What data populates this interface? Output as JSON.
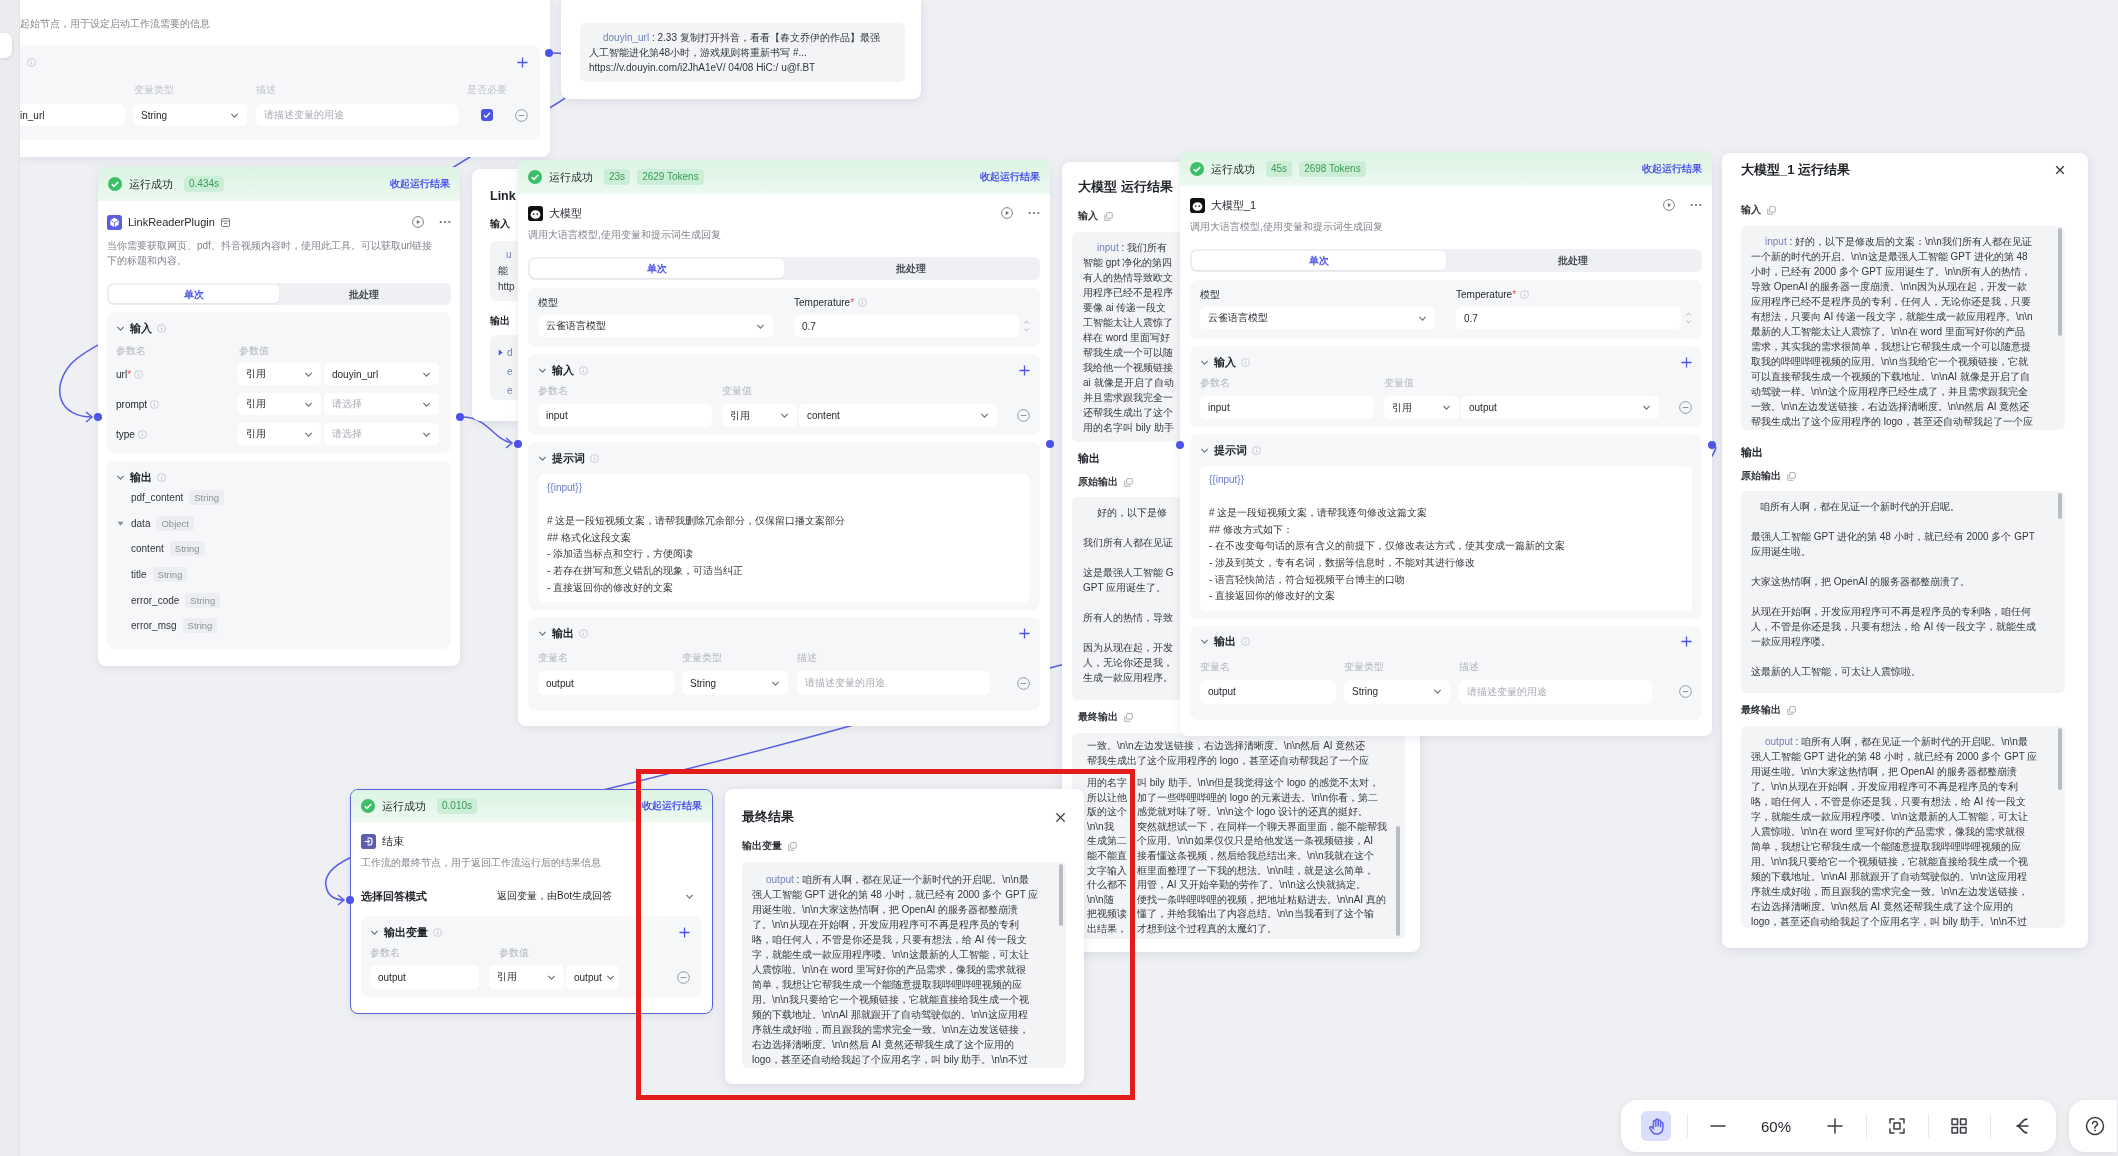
{
  "start_node": {
    "description": "起始节点，用于设定启动工作流需要的信息",
    "columns": [
      "变量类型",
      "描述",
      "是否必要"
    ],
    "variables": [
      {
        "name": "in_url",
        "type": "String",
        "placeholder": "请描述变量的用途",
        "required": true
      }
    ]
  },
  "start_result": {
    "input": {
      "key": "douyin_url",
      "lines": [
        " : 2.33 复制打开抖音，看看【春文乔伊的作品】最强",
        "人工智能进化第48小时，游戏规则将重新书写 #...",
        "https://v.douyin.com/i2JhA1eV/ 04/08 HiC:/ u@f.BT"
      ]
    }
  },
  "link_reader_node": {
    "status": {
      "kind": "success",
      "label": "运行成功",
      "badges": [
        "0.434s"
      ],
      "collapse_link": "收起运行结果"
    },
    "title": "LinkReaderPlugin",
    "description": "当你需要获取网页、pdf、抖音视频内容时，使用此工具。可以获取url链接下的标题和内容。",
    "tabs": [
      {
        "label": "单次",
        "selected": true
      },
      {
        "label": "批处理",
        "selected": false
      }
    ],
    "input": {
      "title": "输入",
      "columns": [
        "参数名",
        "参数值"
      ],
      "params": [
        {
          "name": "url",
          "required_mark": "*",
          "source": "引用",
          "value": "douyin_url"
        },
        {
          "name": "prompt",
          "source": "引用",
          "placeholder": "请选择"
        },
        {
          "name": "type",
          "source": "引用",
          "placeholder": "请选择"
        }
      ]
    },
    "output": {
      "title": "输出",
      "fields": [
        {
          "name": "pdf_content",
          "type": "String"
        },
        {
          "name": "data",
          "type": "Object",
          "expanded": true,
          "children": [
            {
              "name": "content",
              "type": "String"
            },
            {
              "name": "title",
              "type": "String"
            },
            {
              "name": "error_code",
              "type": "String"
            },
            {
              "name": "error_msg",
              "type": "String"
            }
          ]
        }
      ]
    }
  },
  "link_result_panel": {
    "title": "Link",
    "input_label": "输入",
    "input": {
      "key": "u",
      "lines": [
        "能",
        "http"
      ]
    },
    "output_label": "输出",
    "output_items": [
      {
        "name": "d",
        "expanded": false
      },
      {
        "name": "e"
      },
      {
        "name": "e"
      }
    ]
  },
  "llm_nodes": [
    {
      "status": {
        "kind": "success",
        "label": "运行成功",
        "badges": [
          "23s",
          "2629 Tokens"
        ],
        "collapse_link": "收起运行结果"
      },
      "title": "大模型",
      "description": "调用大语言模型,使用变量和提示词生成回复",
      "tabs": [
        {
          "label": "单次",
          "selected": true
        },
        {
          "label": "批处理",
          "selected": false
        }
      ],
      "model": {
        "label": "模型",
        "value": "云雀语言模型"
      },
      "temperature": {
        "label": "Temperature",
        "required_mark": "*",
        "value": "0.7"
      },
      "input": {
        "title": "输入",
        "columns": [
          "参数名",
          "变量值"
        ],
        "params": [
          {
            "name": "input",
            "source": "引用",
            "value": "content"
          }
        ]
      },
      "prompt": {
        "title": "提示词",
        "variable": "{{input}}",
        "lines": [
          "# 这是一段短视频文案，请帮我删除冗余部分，仅保留口播文案部分",
          "## 格式化这段文案",
          "- 添加适当标点和空行，方便阅读",
          "- 若存在拼写和意义错乱的现象，可适当纠正",
          "- 直接返回你的修改好的文案"
        ]
      },
      "output": {
        "title": "输出",
        "columns": [
          "变量名",
          "变量类型",
          "描述"
        ],
        "vars": [
          {
            "name": "output",
            "type": "String",
            "placeholder": "请描述变量的用途"
          }
        ]
      }
    },
    {
      "status": {
        "kind": "success",
        "label": "运行成功",
        "badges": [
          "45s",
          "2698 Tokens"
        ],
        "collapse_link": "收起运行结果"
      },
      "title": "大模型_1",
      "description": "调用大语言模型,使用变量和提示词生成回复",
      "tabs": [
        {
          "label": "单次",
          "selected": true
        },
        {
          "label": "批处理",
          "selected": false
        }
      ],
      "model": {
        "label": "模型",
        "value": "云雀语言模型"
      },
      "temperature": {
        "label": "Temperature",
        "required_mark": "*",
        "value": "0.7"
      },
      "input": {
        "title": "输入",
        "columns": [
          "参数名",
          "变量值"
        ],
        "params": [
          {
            "name": "input",
            "source": "引用",
            "value": "output"
          }
        ]
      },
      "prompt": {
        "title": "提示词",
        "variable": "{{input}}",
        "lines": [
          "# 这是一段短视频文案，请帮我逐句修改这篇文案",
          "## 修改方式如下：",
          "- 在不改变每句话的原有含义的前提下，仅修改表达方式，使其变成一篇新的文案",
          "- 涉及到英文，专有名词，数据等信息时，不能对其进行修改",
          "- 语言轻快简洁，符合短视频平台博主的口吻",
          "- 直接返回你的修改好的文案"
        ]
      },
      "output": {
        "title": "输出",
        "columns": [
          "变量名",
          "变量类型",
          "描述"
        ],
        "vars": [
          {
            "name": "output",
            "type": "String",
            "placeholder": "请描述变量的用途"
          }
        ]
      }
    }
  ],
  "llm_result": {
    "title": "大模型 运行结果",
    "input_label": "输入",
    "input": {
      "key": "input",
      "lines": [
        " : 我们所有",
        "智能 gpt 净化的第四",
        "有人的热情导致欧文",
        "用程序已经不是程序",
        "要像 ai 传递一段文",
        "工智能太让人震惊了",
        "样在 word 里面写好",
        "帮我生成一个可以随",
        "我给他一个视频链接",
        "ai 就像是开启了自动",
        "并且需求跟我完全一",
        "还帮我生成出了这个",
        "用的名字叫 bily 助手"
      ]
    },
    "output_label": "输出",
    "raw_label": "原始输出",
    "raw_output": [
      {
        "lines": [
          "好的，以下是修"
        ]
      },
      {
        "lines": [
          "我们所有人都在见证"
        ]
      },
      {
        "lines": [
          "这是最强人工智能 G",
          "GPT 应用诞生了。"
        ]
      },
      {
        "lines": [
          "所有人的热情，导致"
        ]
      },
      {
        "lines": [
          "因为从现在起，开发",
          "人，无论你还是我，",
          "生成一款应用程序。"
        ]
      }
    ],
    "final_label": "最终输出",
    "final_output": {
      "lines": [
        "一致。\\n\\n左边发送链接，右边选择清晰度。\\n\\n然后 AI 竟然还",
        "帮我生成出了这个应用程序的 logo，甚至还自动帮我起了一个应"
      ],
      "split_lines": [
        {
          "left": "用的名字",
          "right": "叫 bily 助手。\\n\\n但是我觉得这个 logo 的感觉不太对，"
        },
        {
          "left": "所以让他",
          "right": "加了一些哔哩哔哩的 logo 的元素进去。\\n\\n你看，第二"
        },
        {
          "left": "版的这个",
          "right": "感觉就对味了呀。\\n\\n这个 logo 设计的还真的挺好。"
        },
        {
          "left": "\\n\\n我",
          "right": "突然就想试一下，在同样一个聊天界面里面，能不能帮我"
        },
        {
          "left": "生成第二",
          "right": "个应用。\\n\\n如果仅仅只是给他发送一条视频链接，AI"
        },
        {
          "left": "能不能直",
          "right": "接看懂这条视频，然后给我总结出来。\\n\\n我就在这个"
        },
        {
          "left": "文字输入",
          "right": "框里面整理了一下我的想法。\\n\\n哇，就是这么简单，"
        },
        {
          "left": "什么都不",
          "right": "用管，AI 又开始辛勤的劳作了。\\n\\n这么快就搞定。"
        },
        {
          "left": "\\n\\n随",
          "right": "便找一条哔哩哔哩的视频，把地址粘贴进去。\\n\\nAI 真的"
        },
        {
          "left": "把视频读",
          "right": "懂了，并给我输出了内容总结。\\n\\n当我看到了这个输"
        },
        {
          "left": "出结果，",
          "right": "才想到这个过程真的太魔幻了。"
        }
      ]
    }
  },
  "llm_1_result": {
    "title": "大模型_1 运行结果",
    "input_label": "输入",
    "input": {
      "key": "input",
      "lines": [
        " : 好的，以下是修改后的文案：\\n\\n我们所有人都在见证",
        "一个新的时代的开启。\\n\\n这是最强人工智能 GPT 进化的第 48",
        "小时，已经有 2000 多个 GPT 应用诞生了。\\n\\n所有人的热情，",
        "导致 OpenAI 的服务器一度崩溃。\\n\\n因为从现在起，开发一款",
        "应用程序已经不是程序员的专利，任何人，无论你还是我，只要",
        "有想法，只要向 AI 传递一段文字，就能生成一款应用程序。\\n\\n",
        "最新的人工智能太让人震惊了。\\n\\n在 word 里面写好你的产品",
        "需求，其实我的需求很简单，我想让它帮我生成一个可以随意提",
        "取我的哔哩哔哩视频的应用。\\n\\n当我给它一个视频链接，它就",
        "可以直接帮我生成一个视频的下载地址。\\n\\nAI 就像是开启了自",
        "动驾驶一样。\\n\\n这个应用程序已经生成了，并且需求跟我完全",
        "一致。\\n\\n左边发送链接，右边选择清晰度。\\n\\n然后 AI 竟然还",
        "帮我生成出了这个应用程序的 logo，甚至还自动帮我起了一个应"
      ]
    },
    "output_label": "输出",
    "raw_label": "原始输出",
    "raw_output": [
      {
        "lines": [
          "咱所有人啊，都在见证一个新时代的开启呢。"
        ]
      },
      {
        "lines": [
          "最强人工智能 GPT 进化的第 48 小时，就已经有 2000 多个 GPT",
          "应用诞生啦。"
        ]
      },
      {
        "lines": [
          "大家这热情啊，把 OpenAI 的服务器都整崩溃了。"
        ]
      },
      {
        "lines": [
          "从现在开始啊，开发应用程序可不再是程序员的专利咯，咱任何",
          "人，不管是你还是我，只要有想法，给 AI 传一段文字，就能生成",
          "一款应用程序喽。"
        ]
      },
      {
        "lines": [
          "这最新的人工智能，可太让人震惊啦。"
        ]
      }
    ],
    "final_label": "最终输出",
    "final_output": {
      "key": "output",
      "lines": [
        " : 咱所有人啊，都在见证一个新时代的开启呢。\\n\\n最",
        "强人工智能 GPT 进化的第 48 小时，就已经有 2000 多个 GPT 应",
        "用诞生啦。\\n\\n大家这热情啊，把 OpenAI 的服务器都整崩溃",
        "了。\\n\\n从现在开始啊，开发应用程序可不再是程序员的专利",
        "咯，咱任何人，不管是你还是我，只要有想法，给 AI 传一段文",
        "字，就能生成一款应用程序喽。\\n\\n这最新的人工智能，可太让",
        "人震惊啦。\\n\\n在 word 里写好你的产品需求，像我的需求就很",
        "简单，我想让它帮我生成一个能随意提取我哔哩哔哩视频的应",
        "用。\\n\\n我只要给它一个视频链接，它就能直接给我生成一个视",
        "频的下载地址。\\n\\nAI 那就跟开了自动驾驶似的。\\n\\n这应用程",
        "序就生成好啦，而且跟我的需求完全一致。\\n\\n左边发送链接，",
        "右边选择清晰度。\\n\\n然后 AI 竟然还帮我生成了这个应用的",
        "logo，甚至还自动给我起了个应用名字，叫 bily 助手。\\n\\n不过"
      ]
    }
  },
  "end_node": {
    "selected": true,
    "status": {
      "kind": "success",
      "label": "运行成功",
      "badges": [
        "0.010s"
      ],
      "collapse_link": "收起运行结果"
    },
    "title": "结束",
    "description": "工作流的最终节点，用于返回工作流运行后的结果信息",
    "answer_mode": {
      "label": "选择回答模式",
      "value": "返回变量，由Bot生成回答"
    },
    "output": {
      "title": "输出变量",
      "columns": [
        "参数名",
        "参数值"
      ],
      "params": [
        {
          "name": "output",
          "source": "引用",
          "value": "output"
        }
      ]
    }
  },
  "final_result_panel": {
    "title": "最终结果",
    "section_label": "输出变量",
    "output": {
      "key": "output",
      "lines": [
        " : 咱所有人啊，都在见证一个新时代的开启呢。\\n\\n最",
        "强人工智能 GPT 进化的第 48 小时，就已经有 2000 多个 GPT 应",
        "用诞生啦。\\n\\n大家这热情啊，把 OpenAI 的服务器都整崩溃",
        "了。\\n\\n从现在开始啊，开发应用程序可不再是程序员的专利",
        "咯，咱任何人，不管是你还是我，只要有想法，给 AI 传一段文",
        "字，就能生成一款应用程序喽。\\n\\n这最新的人工智能，可太让",
        "人震惊啦。\\n\\n在 word 里写好你的产品需求，像我的需求就很",
        "简单，我想让它帮我生成一个能随意提取我哔哩哔哩视频的应",
        "用。\\n\\n我只要给它一个视频链接，它就能直接给我生成一个视",
        "频的下载地址。\\n\\nAI 那就跟开了自动驾驶似的。\\n\\n这应用程",
        "序就生成好啦，而且跟我的需求完全一致。\\n\\n左边发送链接，",
        "右边选择清晰度。\\n\\n然后 AI 竟然还帮我生成了这个应用的",
        "logo，甚至还自动给我起了个应用名字，叫 bily 助手。\\n\\n不过"
      ]
    }
  },
  "toolbar": {
    "items": [
      {
        "kind": "hand",
        "selected": true
      },
      {
        "kind": "zoom_out"
      },
      {
        "kind": "zoom_level",
        "label": "60%"
      },
      {
        "kind": "zoom_in"
      },
      {
        "kind": "fit"
      },
      {
        "kind": "layout"
      },
      {
        "kind": "branch"
      },
      {
        "kind": "help"
      }
    ]
  }
}
